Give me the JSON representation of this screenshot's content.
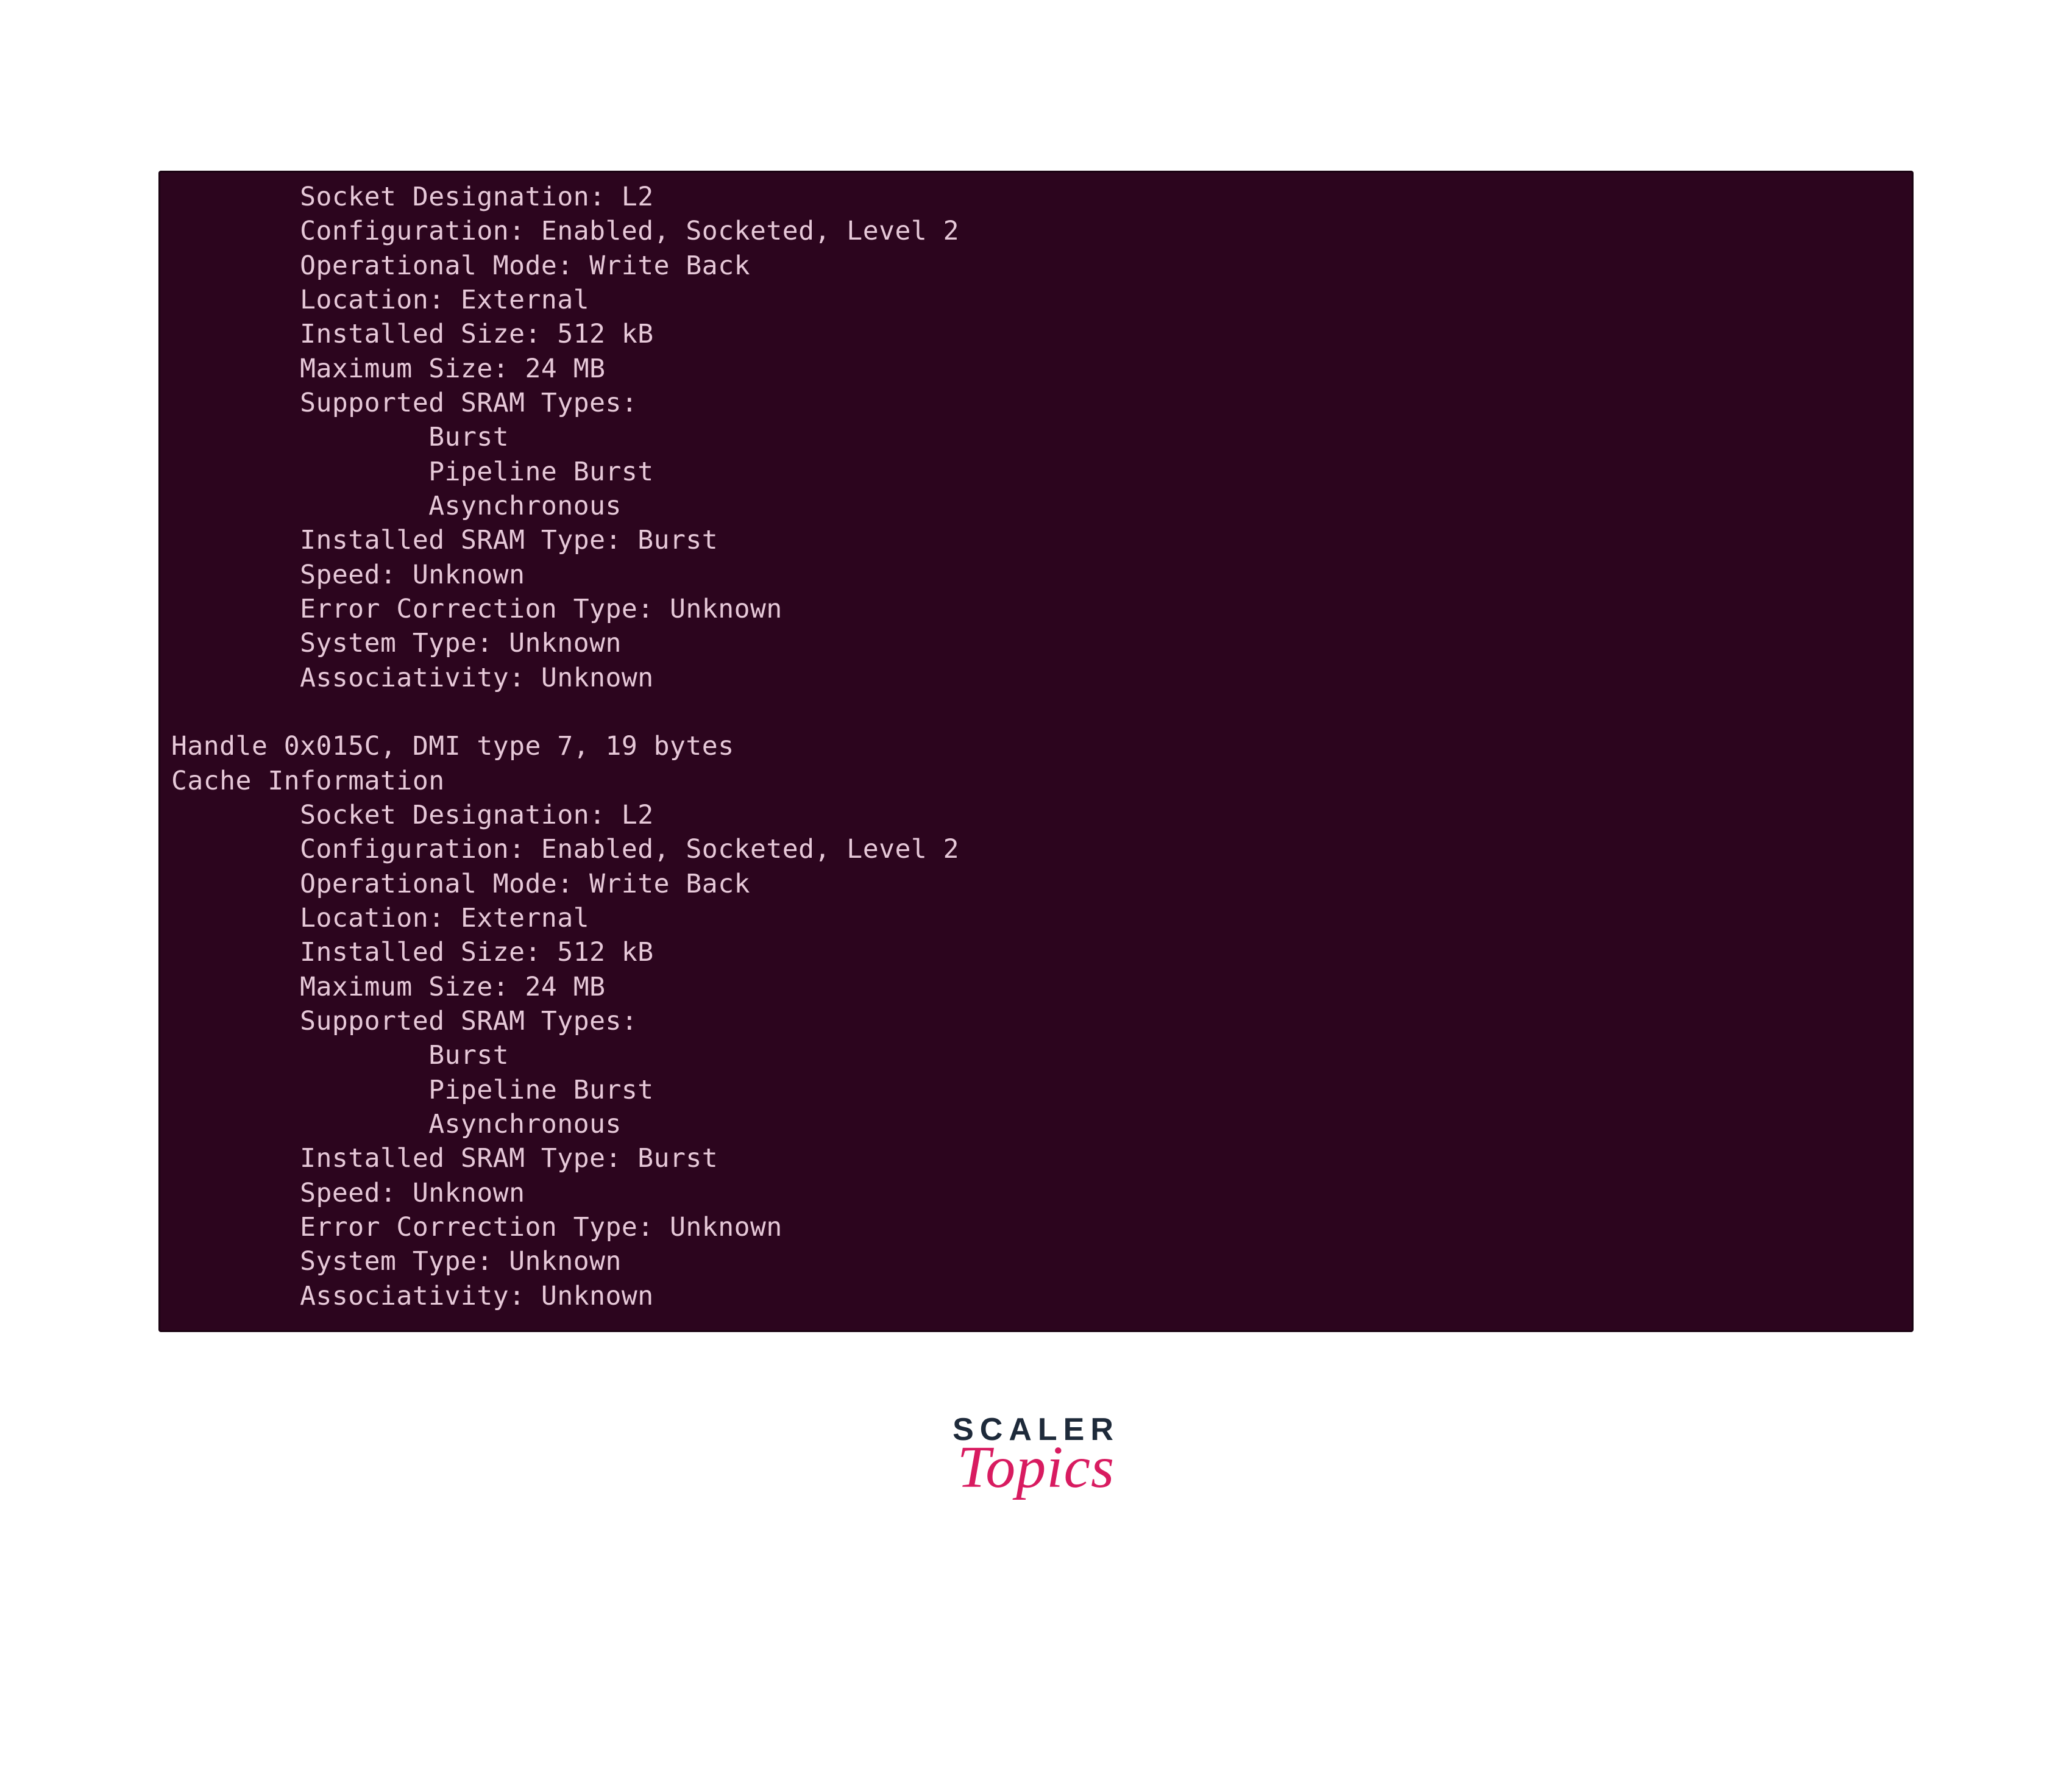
{
  "terminal": {
    "block1": {
      "socket_designation": "        Socket Designation: L2",
      "configuration": "        Configuration: Enabled, Socketed, Level 2",
      "operational_mode": "        Operational Mode: Write Back",
      "location": "        Location: External",
      "installed_size": "        Installed Size: 512 kB",
      "maximum_size": "        Maximum Size: 24 MB",
      "supported_sram_types": "        Supported SRAM Types:",
      "sram_burst": "                Burst",
      "sram_pipeline": "                Pipeline Burst",
      "sram_async": "                Asynchronous",
      "installed_sram_type": "        Installed SRAM Type: Burst",
      "speed": "        Speed: Unknown",
      "error_correction": "        Error Correction Type: Unknown",
      "system_type": "        System Type: Unknown",
      "associativity": "        Associativity: Unknown"
    },
    "blank": "",
    "handle_line": "Handle 0x015C, DMI type 7, 19 bytes",
    "cache_info": "Cache Information",
    "block2": {
      "socket_designation": "        Socket Designation: L2",
      "configuration": "        Configuration: Enabled, Socketed, Level 2",
      "operational_mode": "        Operational Mode: Write Back",
      "location": "        Location: External",
      "installed_size": "        Installed Size: 512 kB",
      "maximum_size": "        Maximum Size: 24 MB",
      "supported_sram_types": "        Supported SRAM Types:",
      "sram_burst": "                Burst",
      "sram_pipeline": "                Pipeline Burst",
      "sram_async": "                Asynchronous",
      "installed_sram_type": "        Installed SRAM Type: Burst",
      "speed": "        Speed: Unknown",
      "error_correction": "        Error Correction Type: Unknown",
      "system_type": "        System Type: Unknown",
      "associativity": "        Associativity: Unknown"
    }
  },
  "logo": {
    "scaler": "SCALER",
    "topics": "Topics"
  }
}
